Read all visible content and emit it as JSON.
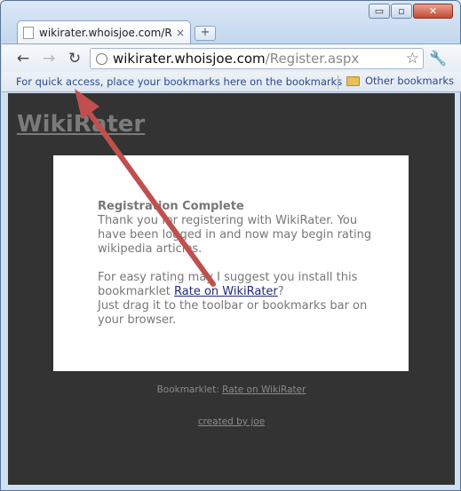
{
  "browser": {
    "tab_title": "wikirater.whoisjoe.com/R...",
    "tab_close": "×",
    "new_tab": "+",
    "window_controls": {
      "minimize": "▭",
      "maximize": "▫",
      "close": "✕"
    },
    "url_host": "wikirater.whoisjoe.com",
    "url_path": "/Register.aspx",
    "bookmarks_hint": "For quick access, place your bookmarks here on the bookmarks ...",
    "other_bookmarks": "Other bookmarks",
    "icons": [
      "back-icon",
      "forward-icon",
      "reload-icon",
      "globe-icon",
      "star-icon",
      "wrench-icon",
      "folder-icon"
    ]
  },
  "page": {
    "site_title": "WikiRater",
    "card": {
      "heading": "Registration Complete",
      "line1": "Thank you for registering with WikiRater. You have been logged in and now may begin rating wikipedia articles.",
      "line2_prefix": "For easy rating may I suggest you install this bookmarklet ",
      "bookmarklet_link": "Rate on WikiRater",
      "line2_suffix": "?",
      "line3": "Just drag it to the toolbar or bookmarks bar on your browser."
    },
    "footer": {
      "bookmarklet_label": "Bookmarklet: ",
      "bookmarklet_link": "Rate on WikiRater",
      "credit_link": "created by joe"
    }
  },
  "colors": {
    "page_background": "#333333",
    "card_background": "#ffffff",
    "annotation_arrow": "#c0504d"
  }
}
